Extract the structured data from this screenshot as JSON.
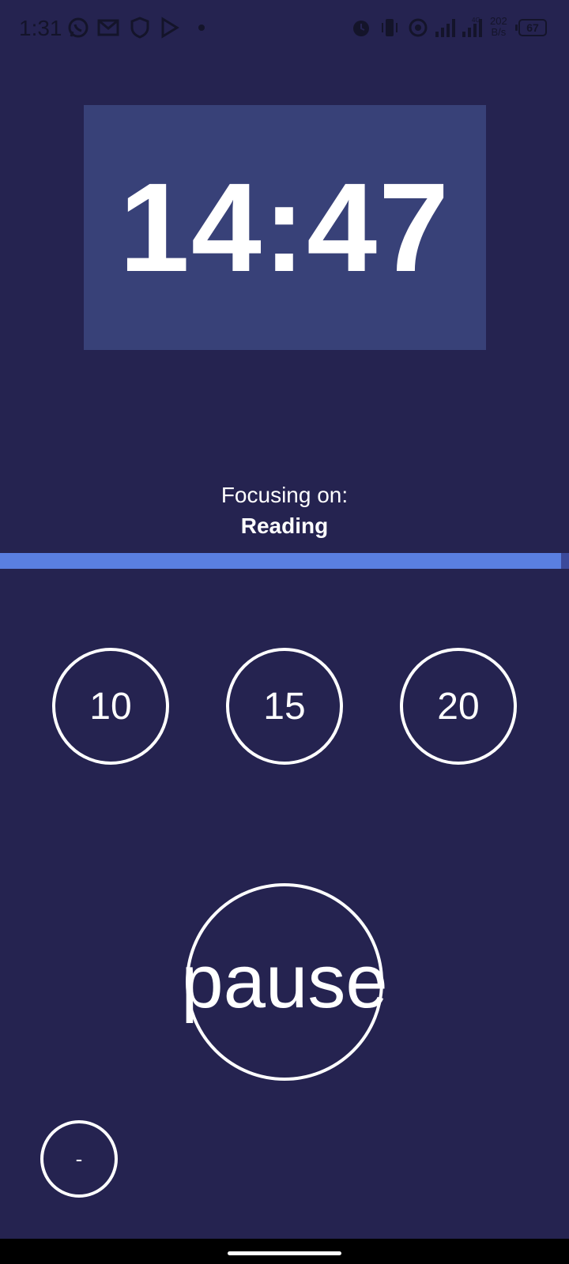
{
  "status_bar": {
    "time": "1:31",
    "network_type": "4G",
    "net_speed_value": "202",
    "net_speed_unit": "B/s",
    "battery": "67",
    "left_icons": [
      "whatsapp-icon",
      "gmail-icon",
      "shield-icon",
      "play-store-icon",
      "dot-icon"
    ],
    "right_icons": [
      "alarm-icon",
      "vibrate-icon",
      "hotspot-icon",
      "signal-icon",
      "signal-icon"
    ]
  },
  "timer": {
    "display": "14:47"
  },
  "focus": {
    "label": "Focusing on:",
    "task": "Reading"
  },
  "progress": {
    "fraction": 0.986
  },
  "presets": [
    "10",
    "15",
    "20"
  ],
  "controls": {
    "pause_label": "pause",
    "minus_label": "-"
  },
  "colors": {
    "background": "#252350",
    "timer_box": "#384178",
    "progress_fill": "#5a7fe0",
    "progress_track": "#3c4a9a",
    "foreground": "#ffffff"
  }
}
